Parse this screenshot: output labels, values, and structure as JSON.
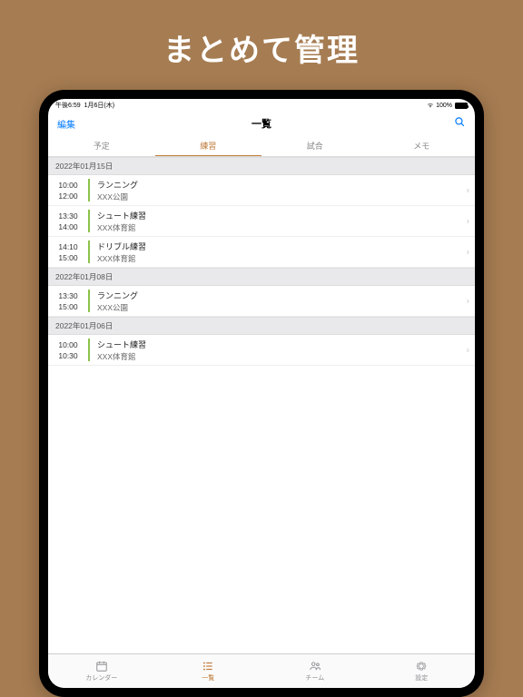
{
  "hero": "まとめて管理",
  "status": {
    "time": "午後6:59",
    "date": "1月6日(木)",
    "batteryPct": "100%"
  },
  "nav": {
    "edit": "編集",
    "title": "一覧"
  },
  "tabs": {
    "t0": "予定",
    "t1": "練習",
    "t2": "試合",
    "t3": "メモ"
  },
  "sections": [
    {
      "header": "2022年01月15日",
      "rows": [
        {
          "start": "10:00",
          "end": "12:00",
          "title": "ランニング",
          "place": "XXX公園"
        },
        {
          "start": "13:30",
          "end": "14:00",
          "title": "シュート練習",
          "place": "XXX体育館"
        },
        {
          "start": "14:10",
          "end": "15:00",
          "title": "ドリブル練習",
          "place": "XXX体育館"
        }
      ]
    },
    {
      "header": "2022年01月08日",
      "rows": [
        {
          "start": "13:30",
          "end": "15:00",
          "title": "ランニング",
          "place": "XXX公園"
        }
      ]
    },
    {
      "header": "2022年01月06日",
      "rows": [
        {
          "start": "10:00",
          "end": "10:30",
          "title": "シュート練習",
          "place": "XXX体育館"
        }
      ]
    }
  ],
  "bottom": {
    "b0": "カレンダー",
    "b1": "一覧",
    "b2": "チーム",
    "b3": "設定"
  }
}
